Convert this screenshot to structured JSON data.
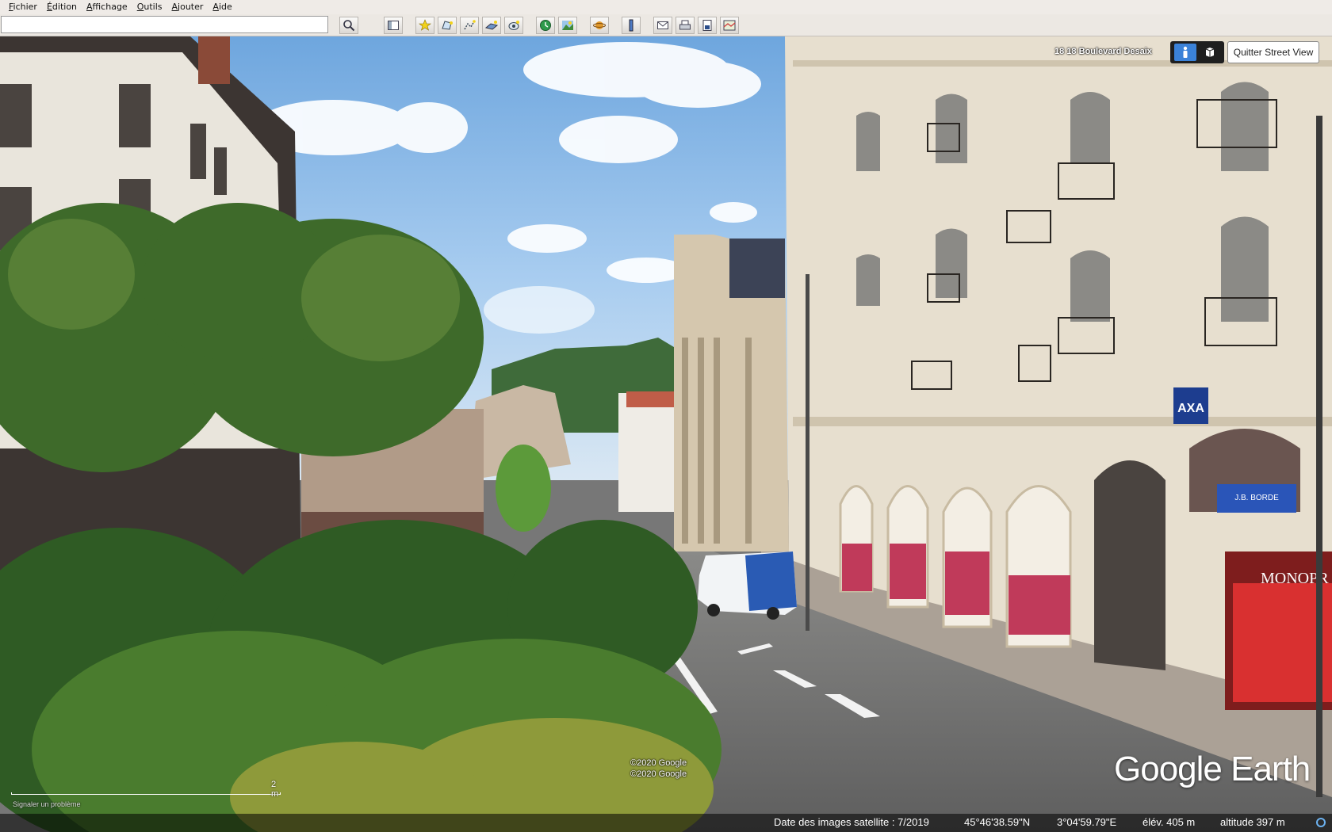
{
  "menubar": {
    "items": [
      {
        "first": "F",
        "rest": "ichier"
      },
      {
        "first": "É",
        "rest": "dition"
      },
      {
        "first": "A",
        "rest": "ffichage"
      },
      {
        "first": "O",
        "rest": "utils"
      },
      {
        "first": "A",
        "rest": "jouter"
      },
      {
        "first": "A",
        "rest": "ide"
      }
    ]
  },
  "toolbar": {
    "search_value": "",
    "buttons": [
      "search-icon",
      "sidebar-icon",
      "placemark-icon",
      "polygon-icon",
      "path-icon",
      "image-overlay-icon",
      "record-tour-icon",
      "historical-imagery-icon",
      "sun-icon",
      "planets-icon",
      "ruler-icon",
      "email-icon",
      "print-icon",
      "save-image-icon",
      "view-in-maps-icon"
    ]
  },
  "streetview": {
    "address": "18 18 Boulevard Desaix",
    "exit_label": "Quitter Street View"
  },
  "copyrights": [
    "©2020 Google",
    "©2020 Google"
  ],
  "logo_text": "Google Earth",
  "scale": {
    "label": "2 m",
    "report_link": "Signaler un problème"
  },
  "status": {
    "imagery_date": "Date des images satellite : 7/2019",
    "latitude": "45°46'38.59\"N",
    "longitude": "3°04'59.79\"E",
    "elevation": "élév.  405 m",
    "altitude": "altitude   397 m"
  },
  "scene_signs": {
    "axa": "AXA",
    "monoprix": "MONOPR",
    "jb_borde": "J.B. BORDE"
  },
  "colors": {
    "sky": "#9ec6ec",
    "accent_blue": "#3b82d8",
    "axa_blue": "#1d3d8f"
  }
}
